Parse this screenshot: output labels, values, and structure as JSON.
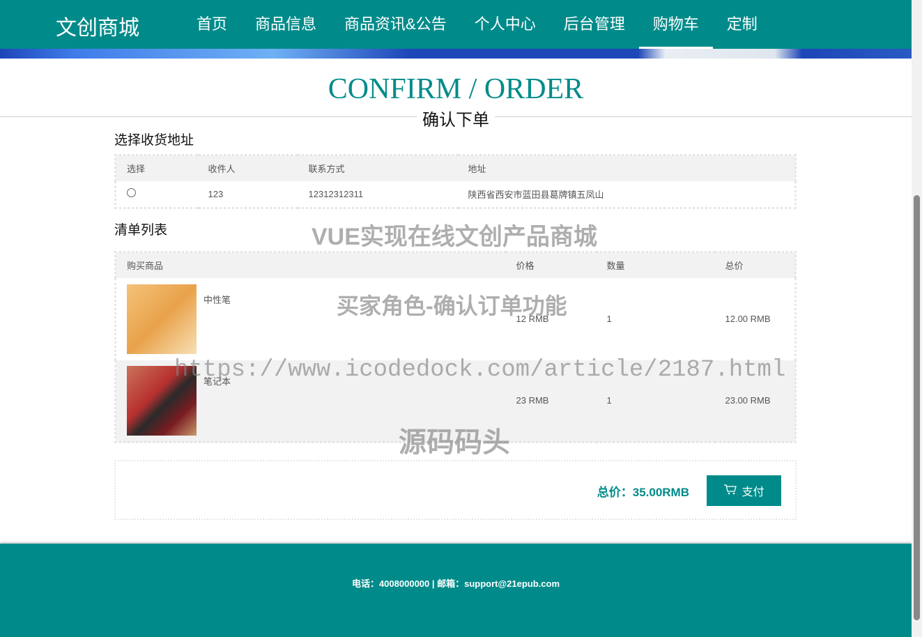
{
  "nav": {
    "logo": "文创商城",
    "items": [
      "首页",
      "商品信息",
      "商品资讯&公告",
      "个人中心",
      "后台管理",
      "购物车",
      "定制"
    ],
    "active": "购物车"
  },
  "page": {
    "title": "CONFIRM / ORDER",
    "subtitle": "确认下单"
  },
  "address": {
    "heading": "选择收货地址",
    "columns": [
      "选择",
      "收件人",
      "联系方式",
      "地址"
    ],
    "rows": [
      {
        "selected": false,
        "name": "123",
        "phone": "12312312311",
        "address": "陕西省西安市蓝田县葛牌镇五凤山"
      }
    ]
  },
  "items": {
    "heading": "清单列表",
    "columns": [
      "购买商品",
      "价格",
      "数量",
      "总价"
    ],
    "rows": [
      {
        "name": "中性笔",
        "price": "12 RMB",
        "qty": "1",
        "total": "12.00 RMB"
      },
      {
        "name": "笔记本",
        "price": "23 RMB",
        "qty": "1",
        "total": "23.00 RMB"
      }
    ]
  },
  "summary": {
    "total": "总价：35.00RMB",
    "pay_label": "支付"
  },
  "footer": {
    "text": "电话：4008000000 | 邮箱：support@21epub.com"
  },
  "watermarks": [
    "VUE实现在线文创产品商城",
    "买家角色-确认订单功能",
    "https://www.icodedock.com/article/2187.html",
    "源码码头"
  ],
  "colors": {
    "primary": "#008b8a"
  }
}
